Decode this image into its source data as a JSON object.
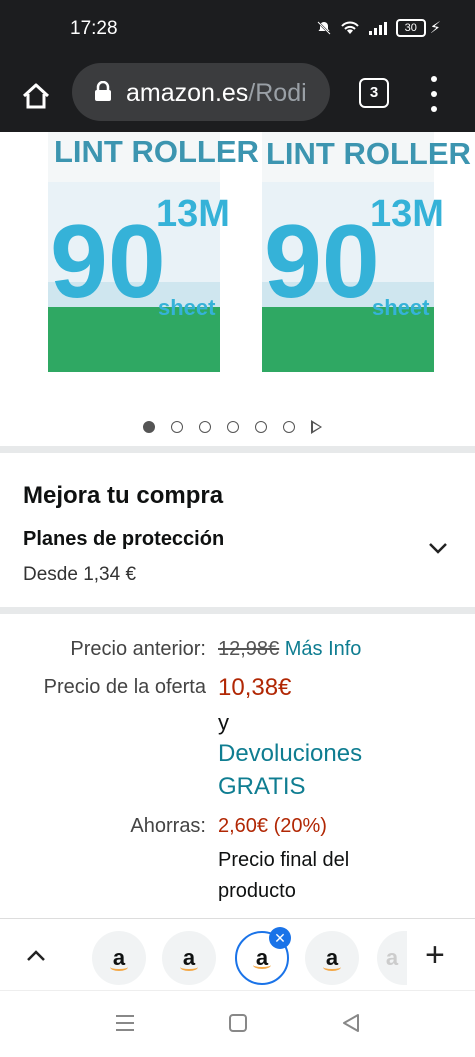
{
  "status": {
    "time": "17:28",
    "battery": "30"
  },
  "browser": {
    "url_domain": "amazon.es",
    "url_path": "/Rodi",
    "tab_count": "3"
  },
  "product_images": {
    "label": "LINT ROLLER",
    "count": "90",
    "length": "13M",
    "unit": "sheet"
  },
  "upgrade": {
    "title": "Mejora tu compra",
    "plan_title": "Planes de protección",
    "plan_sub": "Desde 1,34 €"
  },
  "pricing": {
    "old_label": "Precio anterior:",
    "old_price": "12,98€",
    "more_info": "Más Info",
    "deal_label": "Precio de la oferta",
    "deal_price": "10,38€",
    "and": "y",
    "returns_line1": "Devoluciones",
    "returns_line2": "GRATIS",
    "save_label": "Ahorras:",
    "save_value": "2,60€ (20%)",
    "final_line1": "Precio final del",
    "final_line2": "producto"
  },
  "tabs": {
    "letter": "a"
  },
  "colors": {
    "link": "#0f7d91",
    "deal": "#b12704",
    "chrome": "#1c1d1f",
    "tab_active": "#1a73e8"
  }
}
